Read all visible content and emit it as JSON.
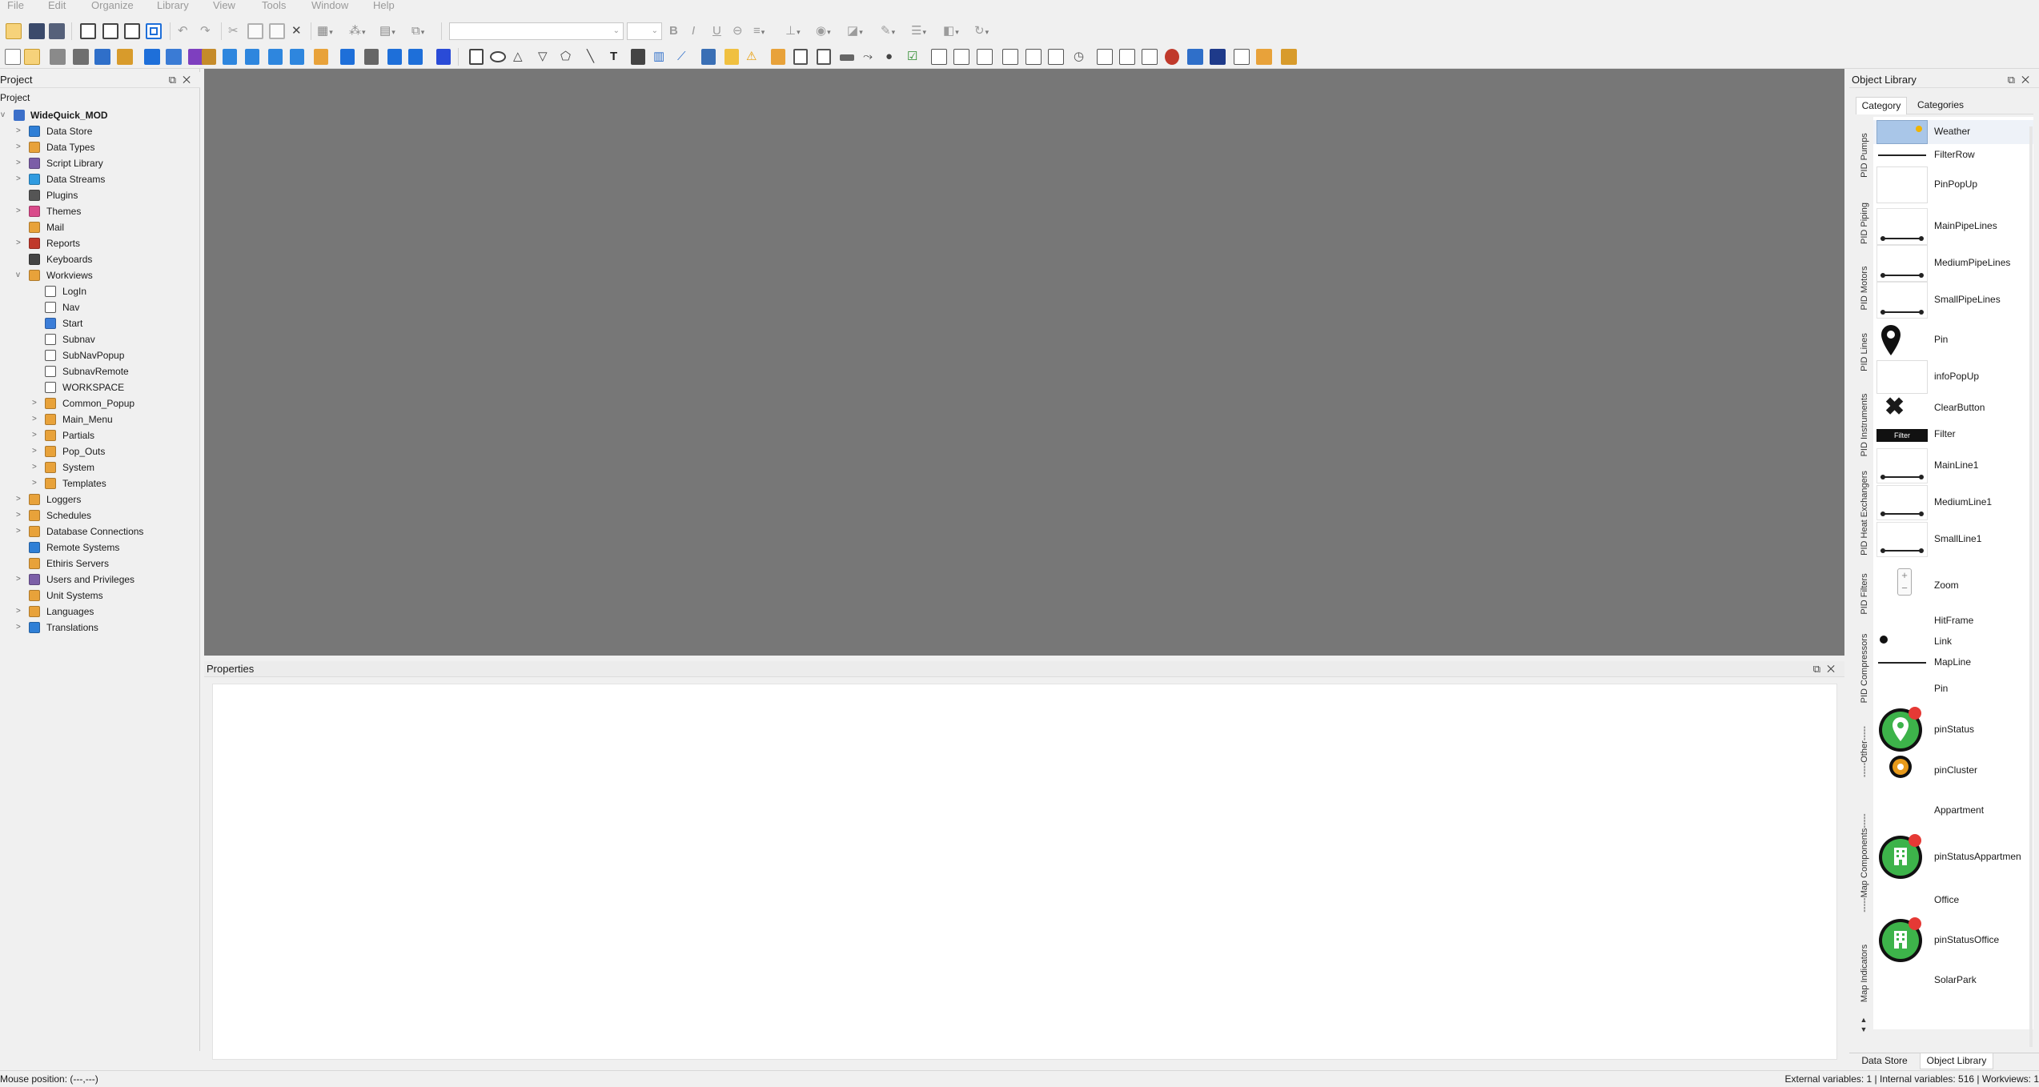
{
  "menu": [
    "File",
    "Edit",
    "Organize",
    "Library",
    "View",
    "Tools",
    "Window",
    "Help"
  ],
  "colors": {
    "canvas": "#777777",
    "panel": "#f0f0f0",
    "accent": "#1e90ff",
    "pin_green": "#3db34a",
    "pin_red": "#e53935",
    "folder": "#e8a23a"
  },
  "project": {
    "header": "Project",
    "title": "Project",
    "root": "WideQuick_MOD",
    "items": [
      {
        "label": "Data Store",
        "icon": "database-icon",
        "level": 1,
        "expand": ">",
        "color": "#2f7fd6"
      },
      {
        "label": "Data Types",
        "icon": "datatypes-icon",
        "level": 1,
        "expand": ">",
        "color": "#e8a23a"
      },
      {
        "label": "Script Library",
        "icon": "script-icon",
        "level": 1,
        "expand": ">",
        "color": "#7b5ea7"
      },
      {
        "label": "Data Streams",
        "icon": "globe-icon",
        "level": 1,
        "expand": ">",
        "color": "#2f9be0"
      },
      {
        "label": "Plugins",
        "icon": "plugin-icon",
        "level": 1,
        "expand": "",
        "color": "#555555"
      },
      {
        "label": "Themes",
        "icon": "palette-icon",
        "level": 1,
        "expand": ">",
        "color": "#d94a8a"
      },
      {
        "label": "Mail",
        "icon": "mail-icon",
        "level": 1,
        "expand": "",
        "color": "#e8a23a"
      },
      {
        "label": "Reports",
        "icon": "report-icon",
        "level": 1,
        "expand": ">",
        "color": "#c0392b"
      },
      {
        "label": "Keyboards",
        "icon": "keyboard-icon",
        "level": 1,
        "expand": "",
        "color": "#444444"
      },
      {
        "label": "Workviews",
        "icon": "folder-icon",
        "level": 1,
        "expand": "v",
        "color": "#e8a23a"
      },
      {
        "label": "LogIn",
        "icon": "page-icon",
        "level": 2,
        "expand": "",
        "color": "#ffffff"
      },
      {
        "label": "Nav",
        "icon": "page-icon",
        "level": 2,
        "expand": "",
        "color": "#ffffff"
      },
      {
        "label": "Start",
        "icon": "start-page-icon",
        "level": 2,
        "expand": "",
        "color": "#3b7dd8"
      },
      {
        "label": "Subnav",
        "icon": "page-icon",
        "level": 2,
        "expand": "",
        "color": "#ffffff"
      },
      {
        "label": "SubNavPopup",
        "icon": "page-icon",
        "level": 2,
        "expand": "",
        "color": "#ffffff"
      },
      {
        "label": "SubnavRemote",
        "icon": "page-icon",
        "level": 2,
        "expand": "",
        "color": "#ffffff"
      },
      {
        "label": "WORKSPACE",
        "icon": "page-icon",
        "level": 2,
        "expand": "",
        "color": "#ffffff"
      },
      {
        "label": "Common_Popup",
        "icon": "folder-icon",
        "level": 2,
        "expand": ">",
        "color": "#e8a23a"
      },
      {
        "label": "Main_Menu",
        "icon": "folder-icon",
        "level": 2,
        "expand": ">",
        "color": "#e8a23a"
      },
      {
        "label": "Partials",
        "icon": "folder-icon",
        "level": 2,
        "expand": ">",
        "color": "#e8a23a"
      },
      {
        "label": "Pop_Outs",
        "icon": "folder-icon",
        "level": 2,
        "expand": ">",
        "color": "#e8a23a"
      },
      {
        "label": "System",
        "icon": "folder-icon",
        "level": 2,
        "expand": ">",
        "color": "#e8a23a"
      },
      {
        "label": "Templates",
        "icon": "folder-icon",
        "level": 2,
        "expand": ">",
        "color": "#e8a23a"
      },
      {
        "label": "Loggers",
        "icon": "folder-icon",
        "level": 1,
        "expand": ">",
        "color": "#e8a23a"
      },
      {
        "label": "Schedules",
        "icon": "folder-icon",
        "level": 1,
        "expand": ">",
        "color": "#e8a23a"
      },
      {
        "label": "Database Connections",
        "icon": "db-connection-icon",
        "level": 1,
        "expand": ">",
        "color": "#e8a23a"
      },
      {
        "label": "Remote Systems",
        "icon": "remote-icon",
        "level": 1,
        "expand": "",
        "color": "#2f7fd6"
      },
      {
        "label": "Ethiris Servers",
        "icon": "server-icon",
        "level": 1,
        "expand": "",
        "color": "#e8a23a"
      },
      {
        "label": "Users and Privileges",
        "icon": "users-icon",
        "level": 1,
        "expand": ">",
        "color": "#7b5ea7"
      },
      {
        "label": "Unit Systems",
        "icon": "units-icon",
        "level": 1,
        "expand": "",
        "color": "#e8a23a"
      },
      {
        "label": "Languages",
        "icon": "folder-icon",
        "level": 1,
        "expand": ">",
        "color": "#e8a23a"
      },
      {
        "label": "Translations",
        "icon": "translate-icon",
        "level": 1,
        "expand": ">",
        "color": "#2f7fd6"
      }
    ]
  },
  "properties": {
    "header": "Properties"
  },
  "object_library": {
    "header": "Object Library",
    "tabs": [
      "Category",
      "Categories"
    ],
    "vertical_tabs": [
      "PID Pumps",
      "PID Piping",
      "PID Motors",
      "PID Lines",
      "PID Instruments",
      "PID Heat Exchangers",
      "PID Filters",
      "PID Compressors",
      "-----Other-----",
      "-----Map Components-----",
      "Map Indicators"
    ],
    "items": [
      {
        "name": "Weather",
        "thumb": "weather"
      },
      {
        "name": "FilterRow",
        "thumb": "line"
      },
      {
        "name": "PinPopUp",
        "thumb": "card"
      },
      {
        "name": "MainPipeLines",
        "thumb": "pipeline"
      },
      {
        "name": "MediumPipeLines",
        "thumb": "pipeline"
      },
      {
        "name": "SmallPipeLines",
        "thumb": "pipeline"
      },
      {
        "name": "Pin",
        "thumb": "pin"
      },
      {
        "name": "infoPopUp",
        "thumb": "card"
      },
      {
        "name": "ClearButton",
        "thumb": "x"
      },
      {
        "name": "Filter",
        "thumb": "filterbtn",
        "thumb_text": "Filter"
      },
      {
        "name": "MainLine1",
        "thumb": "pipeline"
      },
      {
        "name": "MediumLine1",
        "thumb": "pipeline"
      },
      {
        "name": "SmallLine1",
        "thumb": "pipeline"
      },
      {
        "name": "Zoom",
        "thumb": "zoom"
      },
      {
        "name": "HitFrame",
        "thumb": "none"
      },
      {
        "name": "Link",
        "thumb": "dot"
      },
      {
        "name": "MapLine",
        "thumb": "line"
      },
      {
        "name": "Pin",
        "thumb": "none"
      },
      {
        "name": "pinStatus",
        "thumb": "pinstatus"
      },
      {
        "name": "pinCluster",
        "thumb": "cluster"
      },
      {
        "name": "Appartment",
        "thumb": "none"
      },
      {
        "name": "pinStatusAppartmen",
        "thumb": "building"
      },
      {
        "name": "Office",
        "thumb": "none"
      },
      {
        "name": "pinStatusOffice",
        "thumb": "office"
      },
      {
        "name": "SolarPark",
        "thumb": "none"
      }
    ],
    "bottom_tabs": [
      "Data Store",
      "Object Library"
    ]
  },
  "status": {
    "mouse": "Mouse position: (---,---)",
    "right": "External variables: 1 | Internal variables: 516 | Workviews: 1"
  }
}
